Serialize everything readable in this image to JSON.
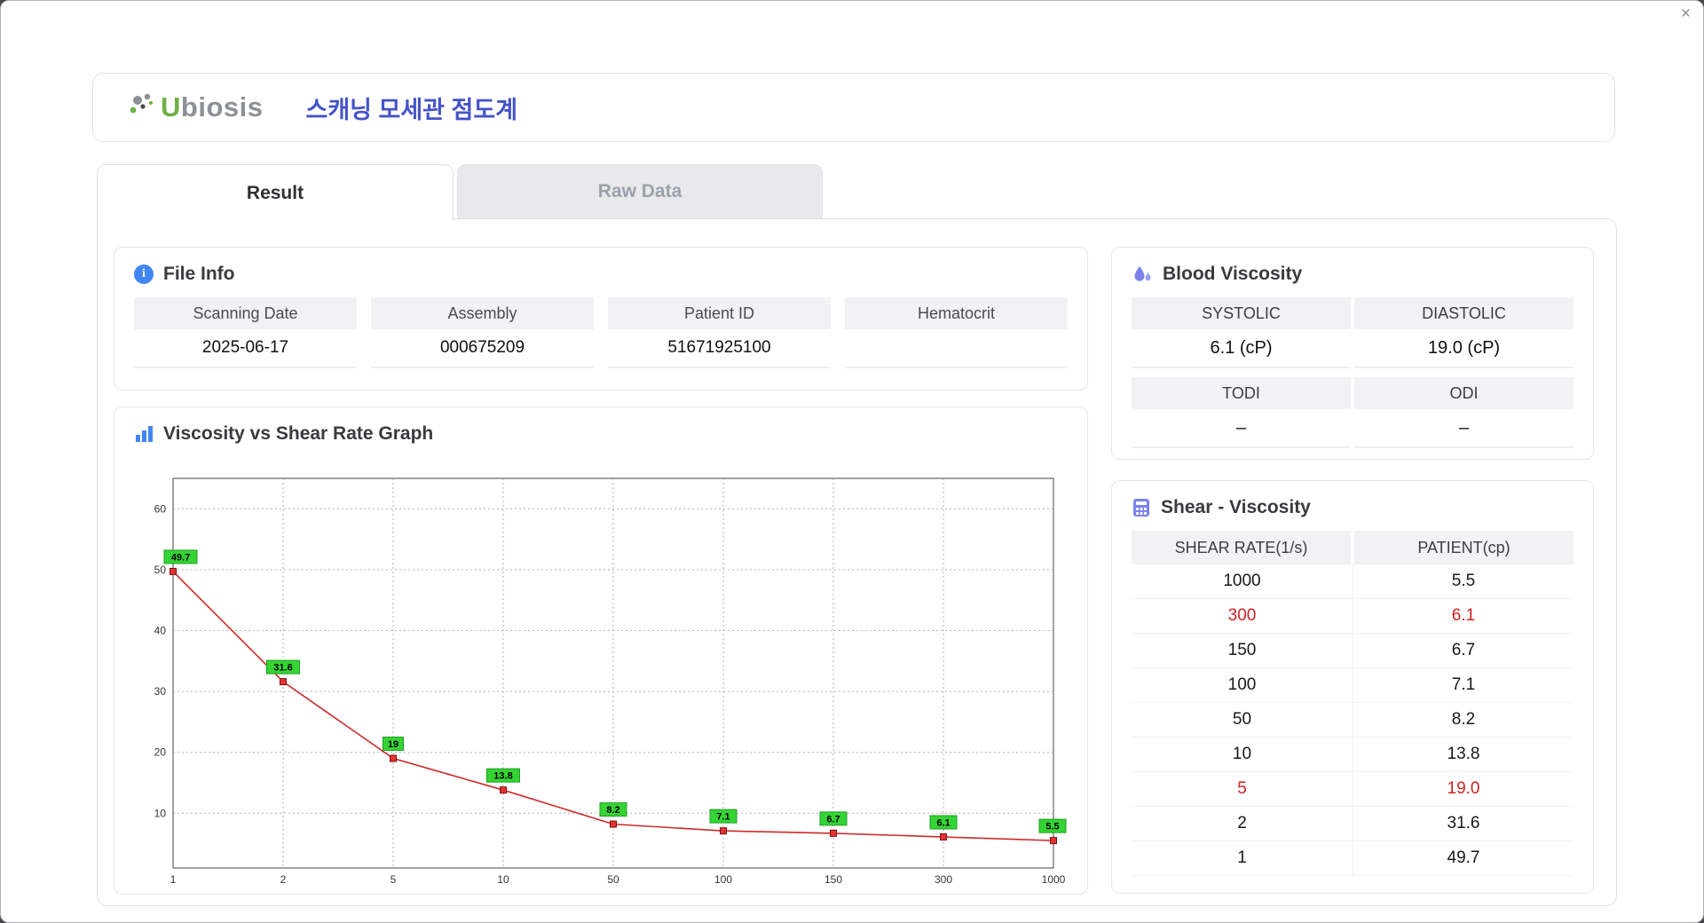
{
  "window": {
    "close_label": "×"
  },
  "header": {
    "logo_u": "U",
    "logo_rest": "biosis",
    "title": "스캐닝 모세관 점도계"
  },
  "tabs": [
    {
      "label": "Result",
      "active": true
    },
    {
      "label": "Raw Data",
      "active": false
    }
  ],
  "file_info": {
    "title": "File Info",
    "fields": [
      {
        "label": "Scanning Date",
        "value": "2025-06-17"
      },
      {
        "label": "Assembly",
        "value": "000675209"
      },
      {
        "label": "Patient ID",
        "value": "51671925100"
      },
      {
        "label": "Hematocrit",
        "value": ""
      }
    ]
  },
  "blood_viscosity": {
    "title": "Blood Viscosity",
    "cells": [
      {
        "label": "SYSTOLIC",
        "value": "6.1 (cP)"
      },
      {
        "label": "DIASTOLIC",
        "value": "19.0 (cP)"
      },
      {
        "label": "TODI",
        "value": "–"
      },
      {
        "label": "ODI",
        "value": "–"
      }
    ]
  },
  "shear_table": {
    "title": "Shear - Viscosity",
    "columns": [
      "SHEAR RATE(1/s)",
      "PATIENT(cp)"
    ],
    "rows": [
      {
        "rate": "1000",
        "patient": "5.5",
        "highlight": false
      },
      {
        "rate": "300",
        "patient": "6.1",
        "highlight": true
      },
      {
        "rate": "150",
        "patient": "6.7",
        "highlight": false
      },
      {
        "rate": "100",
        "patient": "7.1",
        "highlight": false
      },
      {
        "rate": "50",
        "patient": "8.2",
        "highlight": false
      },
      {
        "rate": "10",
        "patient": "13.8",
        "highlight": false
      },
      {
        "rate": "5",
        "patient": "19.0",
        "highlight": true
      },
      {
        "rate": "2",
        "patient": "31.6",
        "highlight": false
      },
      {
        "rate": "1",
        "patient": "49.7",
        "highlight": false
      }
    ]
  },
  "chart_data": {
    "type": "line",
    "title": "Viscosity vs Shear Rate Graph",
    "xlabel": "",
    "ylabel": "",
    "x": [
      1,
      2,
      5,
      10,
      50,
      100,
      150,
      300,
      1000
    ],
    "x_tick_labels": [
      "1",
      "2",
      "5",
      "10",
      "50",
      "100",
      "150",
      "300",
      "1000"
    ],
    "x_scale": "categorical",
    "values": [
      49.7,
      31.6,
      19,
      13.8,
      8.2,
      7.1,
      6.7,
      6.1,
      5.5
    ],
    "point_labels": [
      "49.7",
      "31.6",
      "19",
      "13.8",
      "8.2",
      "7.1",
      "6.7",
      "6.1",
      "5.5"
    ],
    "y_ticks": [
      10,
      20,
      30,
      40,
      50,
      60
    ],
    "ylim": [
      1,
      65
    ],
    "grid": true,
    "legend": "none",
    "line_color": "#cc2b2b",
    "marker_color": "#e23333",
    "label_bg": "#35d435",
    "label_border": "#1f9e1f"
  }
}
